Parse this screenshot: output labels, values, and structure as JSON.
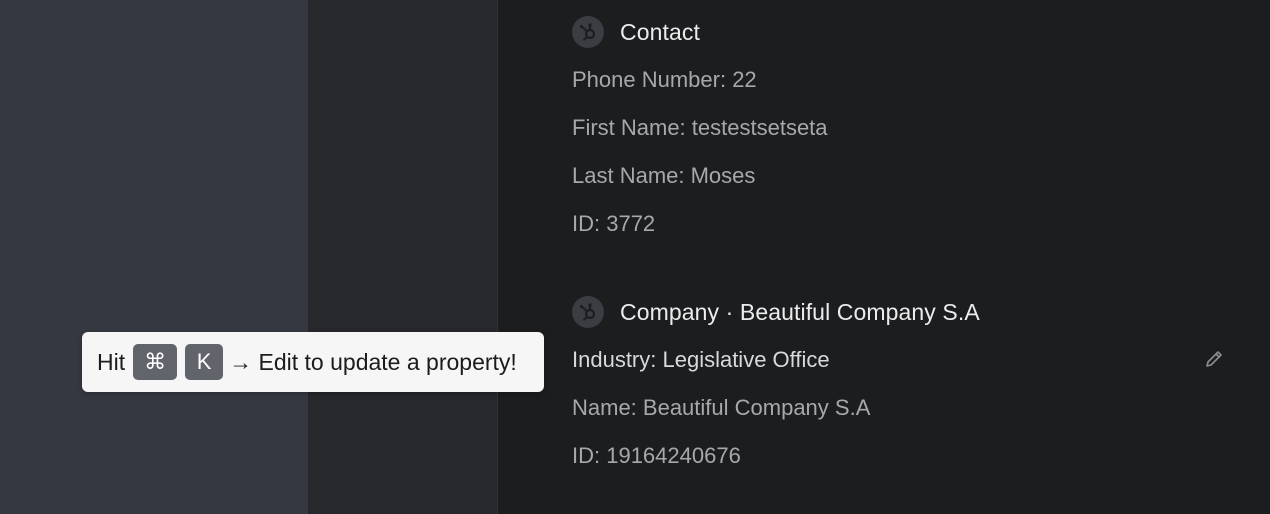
{
  "records": [
    {
      "title": "Contact",
      "logo_icon": "hubspot-icon",
      "properties": [
        "Phone Number: 22",
        "First Name: testestsetseta",
        "Last Name: Moses",
        "ID: 3772"
      ]
    },
    {
      "title": "Company · Beautiful Company S.A",
      "logo_icon": "hubspot-icon",
      "properties": [
        "Industry: Legislative Office",
        "Name: Beautiful Company S.A",
        "ID: 19164240676"
      ],
      "edit_icon": "pencil-icon"
    }
  ],
  "tooltip": {
    "prefix": "Hit",
    "key_cmd": "⌘",
    "key_k": "K",
    "suffix": "→ Edit to update a property!"
  },
  "colors": {
    "left_panel": "#363841",
    "middle_panel": "#27282c",
    "main_panel": "#1c1d1f",
    "tooltip_bg": "#f6f6f7",
    "key_bg": "#62646b"
  }
}
